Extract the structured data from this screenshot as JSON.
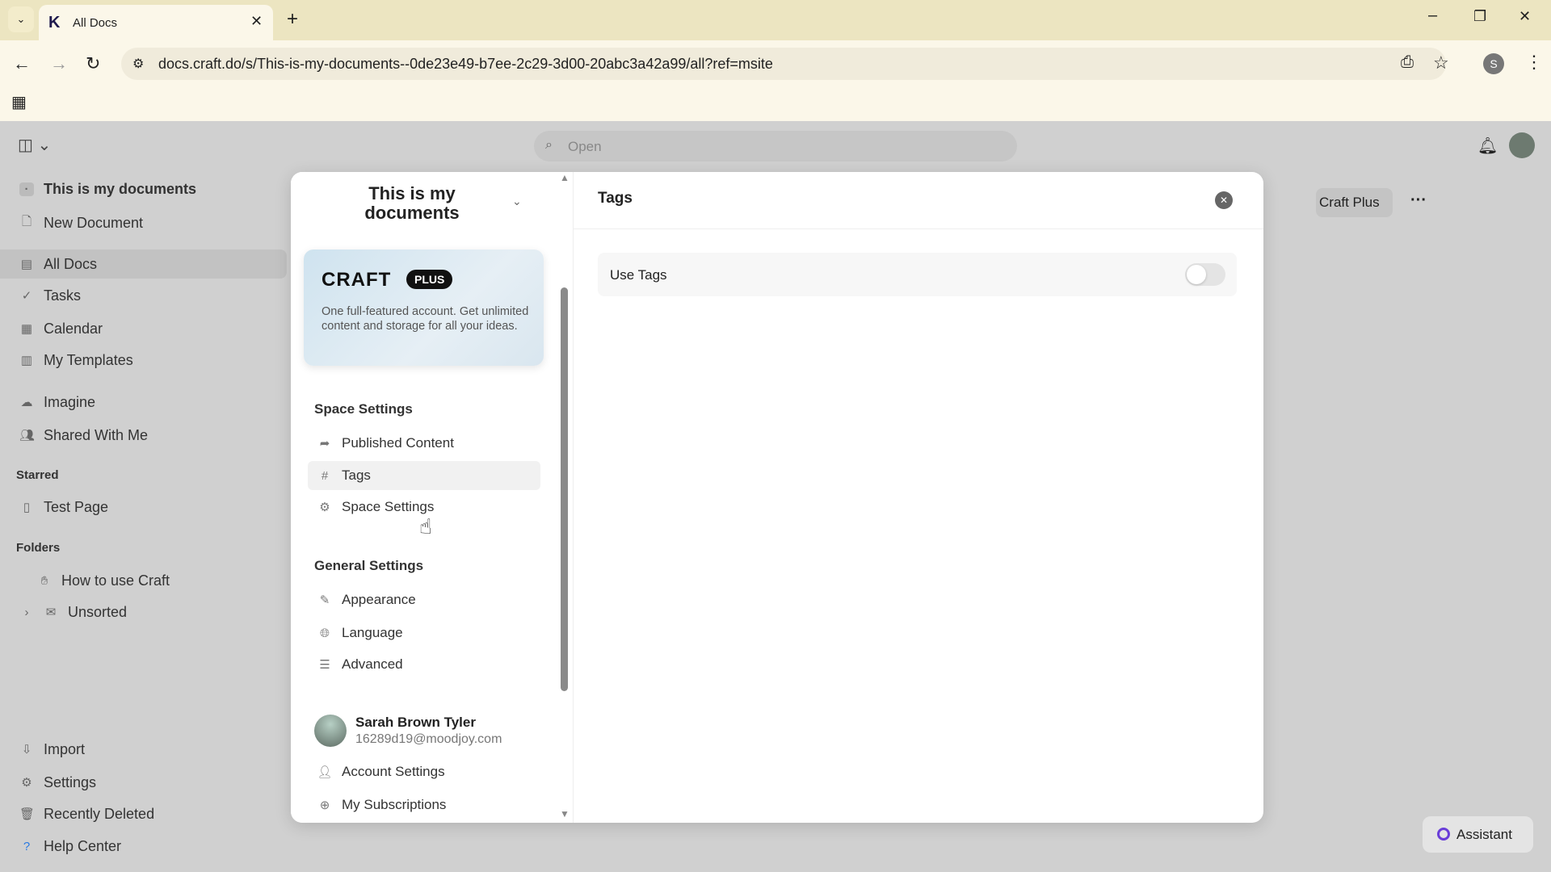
{
  "browser": {
    "tab_title": "All Docs",
    "url": "docs.craft.do/s/This-is-my-documents--0de23e49-b7ee-2c29-3d00-20abc3a42a99/all?ref=msite",
    "profile_initial": "S"
  },
  "topbar": {
    "search_placeholder": "Open",
    "craft_plus_label": "Craft Plus",
    "more": "···"
  },
  "sidebar": {
    "space": "This is my documents",
    "items": [
      "New Document",
      "All Docs",
      "Tasks",
      "Calendar",
      "My Templates",
      "Imagine",
      "Shared With Me"
    ],
    "starred_heading": "Starred",
    "starred": [
      "Test Page"
    ],
    "folders_heading": "Folders",
    "folders": [
      "How to use Craft",
      "Unsorted"
    ],
    "bottom": [
      "Import",
      "Settings",
      "Recently Deleted",
      "Help Center"
    ]
  },
  "modal": {
    "space_title": "This is my documents",
    "plus": {
      "logo": "CRAFT",
      "badge": "PLUS",
      "text": "One full-featured account. Get unlimited content and storage for all your ideas."
    },
    "space_heading": "Space Settings",
    "space_items": [
      "Published Content",
      "Tags",
      "Space Settings"
    ],
    "general_heading": "General Settings",
    "general_items": [
      "Appearance",
      "Language",
      "Advanced"
    ],
    "user": {
      "name": "Sarah Brown Tyler",
      "email": "16289d19@moodjoy.com"
    },
    "account_items": [
      "Account Settings",
      "My Subscriptions"
    ],
    "panel_title": "Tags",
    "use_tags_label": "Use Tags",
    "use_tags_enabled": false
  },
  "assistant": "Assistant"
}
